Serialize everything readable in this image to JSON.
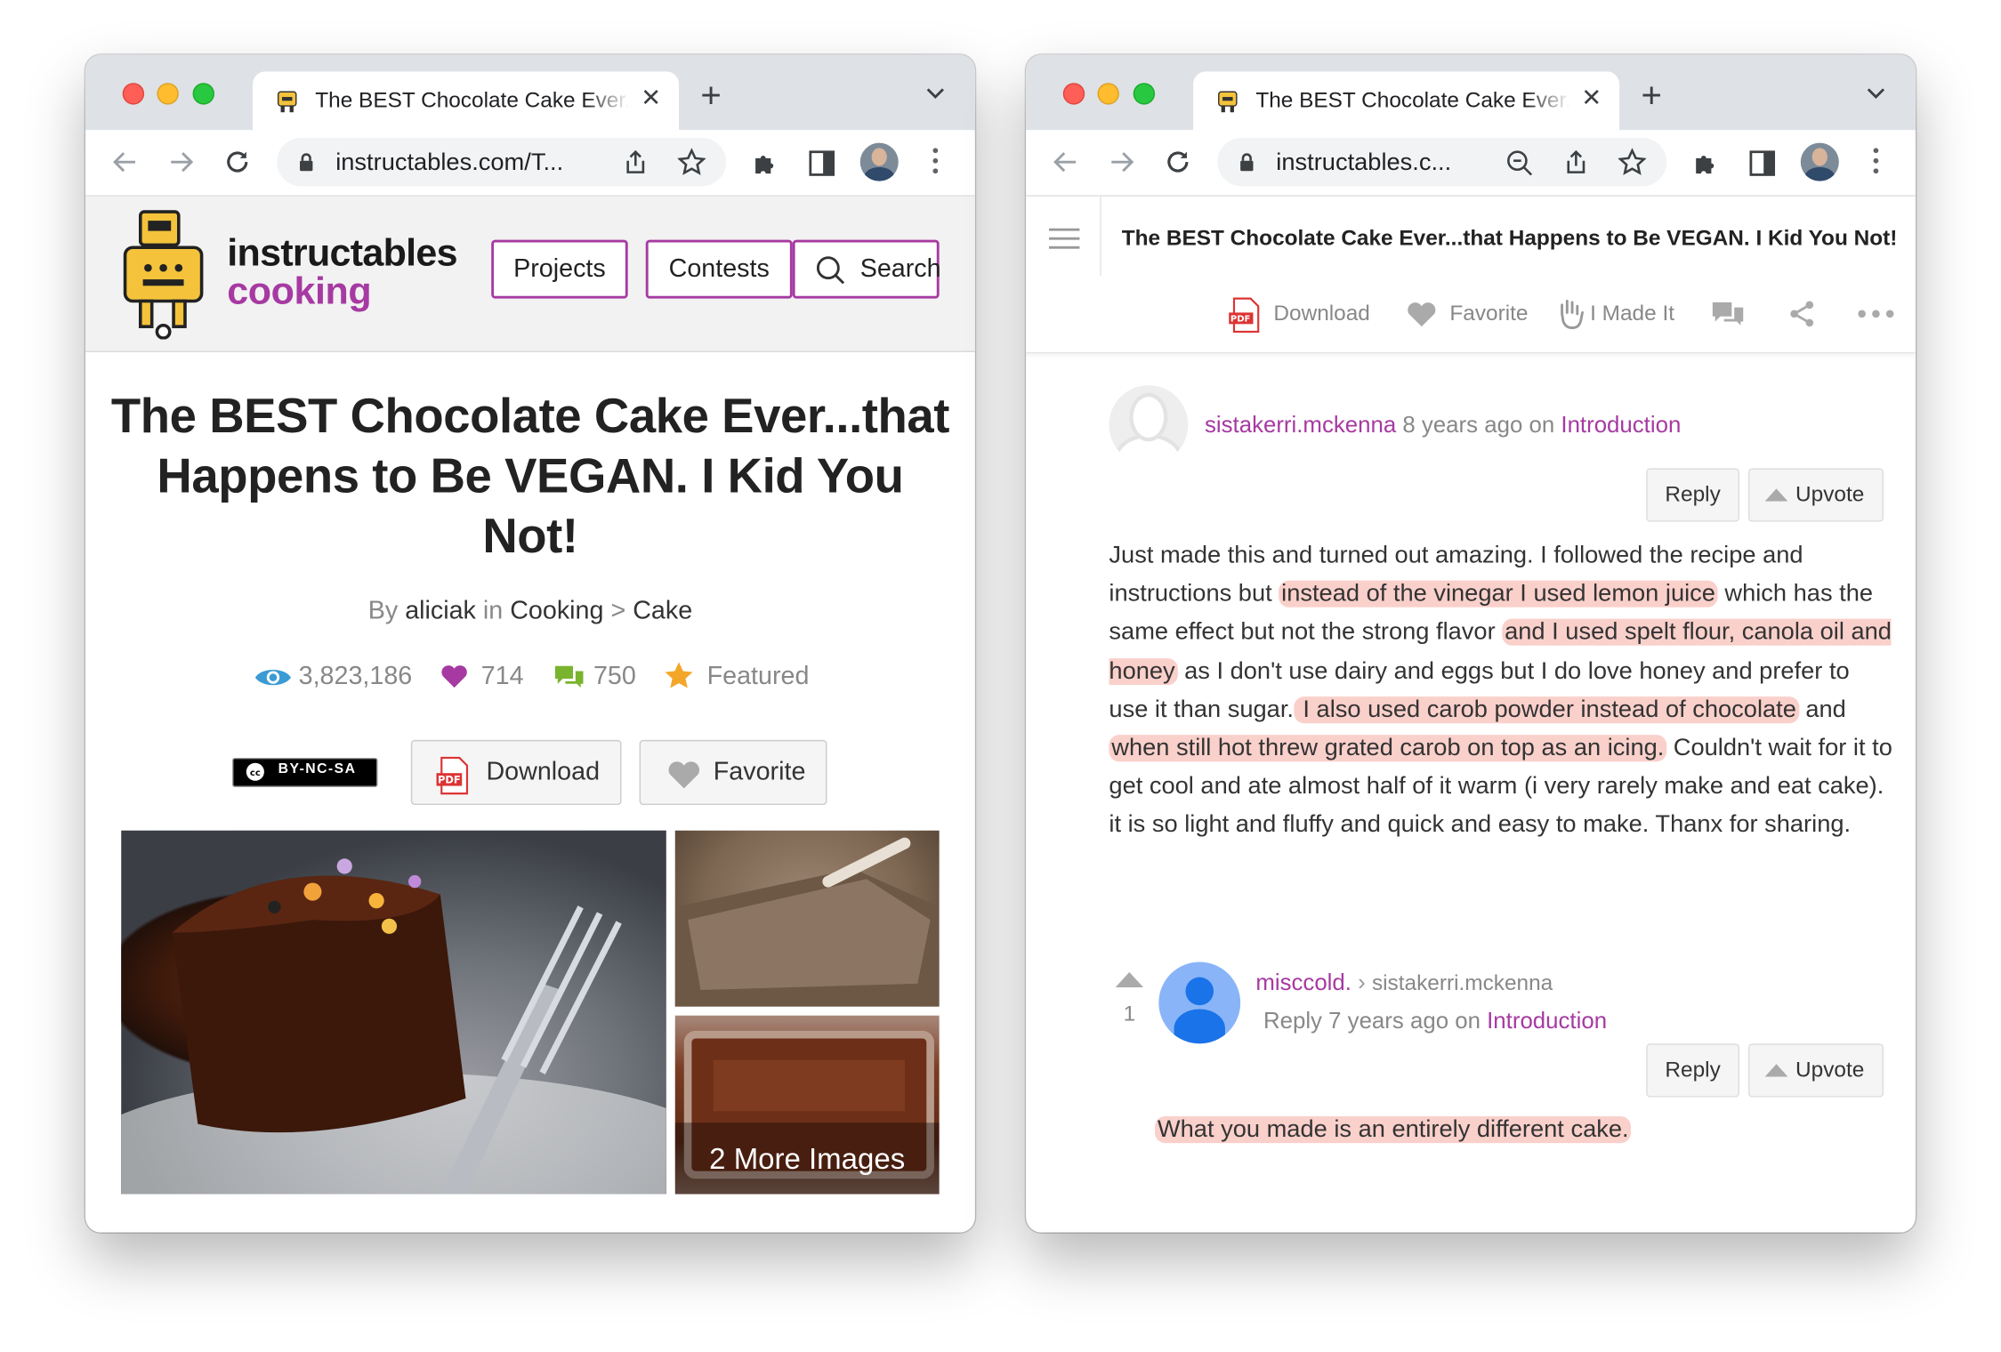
{
  "window_left": {
    "tab_title": "The BEST Chocolate Cake Ever...",
    "url": "instructables.com/T...",
    "site": {
      "brand_top": "instructables",
      "brand_bottom": "cooking",
      "nav": [
        "Projects",
        "Contests",
        "Search"
      ]
    },
    "article": {
      "title": "The BEST Chocolate Cake Ever...that Happens to Be VEGAN. I Kid You Not!",
      "by": "By",
      "author": "aliciak",
      "in": "in",
      "category": "Cooking",
      "sep": ">",
      "subcategory": "Cake",
      "views": "3,823,186",
      "favorites": "714",
      "comments": "750",
      "featured": "Featured",
      "license": "BY-NC-SA",
      "download_label": "Download",
      "favorite_label": "Favorite",
      "more_images": "2 More Images"
    }
  },
  "window_right": {
    "tab_title": "The BEST Chocolate Cake Ever...",
    "url": "instructables.c...",
    "header_title": "The BEST Chocolate Cake Ever...that Happens to Be VEGAN. I Kid You Not!",
    "actions": [
      "Download",
      "Favorite",
      "I Made It"
    ],
    "comment": {
      "user": "sistakerri.mckenna",
      "time": "8 years ago on",
      "section": "Introduction",
      "reply_label": "Reply",
      "upvote_label": "Upvote",
      "text": {
        "t1": "Just made this and turned out amazing. I followed the recipe and instructions but ",
        "h1": "instead of the vinegar I used lemon juice",
        "t2": " which has the same effect but not the strong flavor ",
        "h2": "and I used spelt flour, canola oil and honey",
        "t3": " as I don't use dairy and eggs but I do love honey and prefer to use it than sugar.",
        "h3": " I also used carob powder instead of chocolate",
        "t4": " and ",
        "h4": "when still hot threw grated carob on top as an icing.",
        "t5": " Couldn't wait for it to get cool and ate almost half of it warm (i very rarely make and eat cake). it is so light and fluffy and quick and easy to make. Thanx for sharing."
      }
    },
    "reply": {
      "votes": "1",
      "user": "misccold.",
      "to": "sistakerri.mckenna",
      "time": "Reply 7 years ago on",
      "section": "Introduction",
      "reply_label": "Reply",
      "upvote_label": "Upvote",
      "text": "What you made is an entirely different cake."
    }
  },
  "colors": {
    "brand": "#a63aa2",
    "highlight": "#f5aaa0",
    "featured": "#f4a62a",
    "comment": "#7ab32e",
    "views": "#3a9bd5"
  }
}
